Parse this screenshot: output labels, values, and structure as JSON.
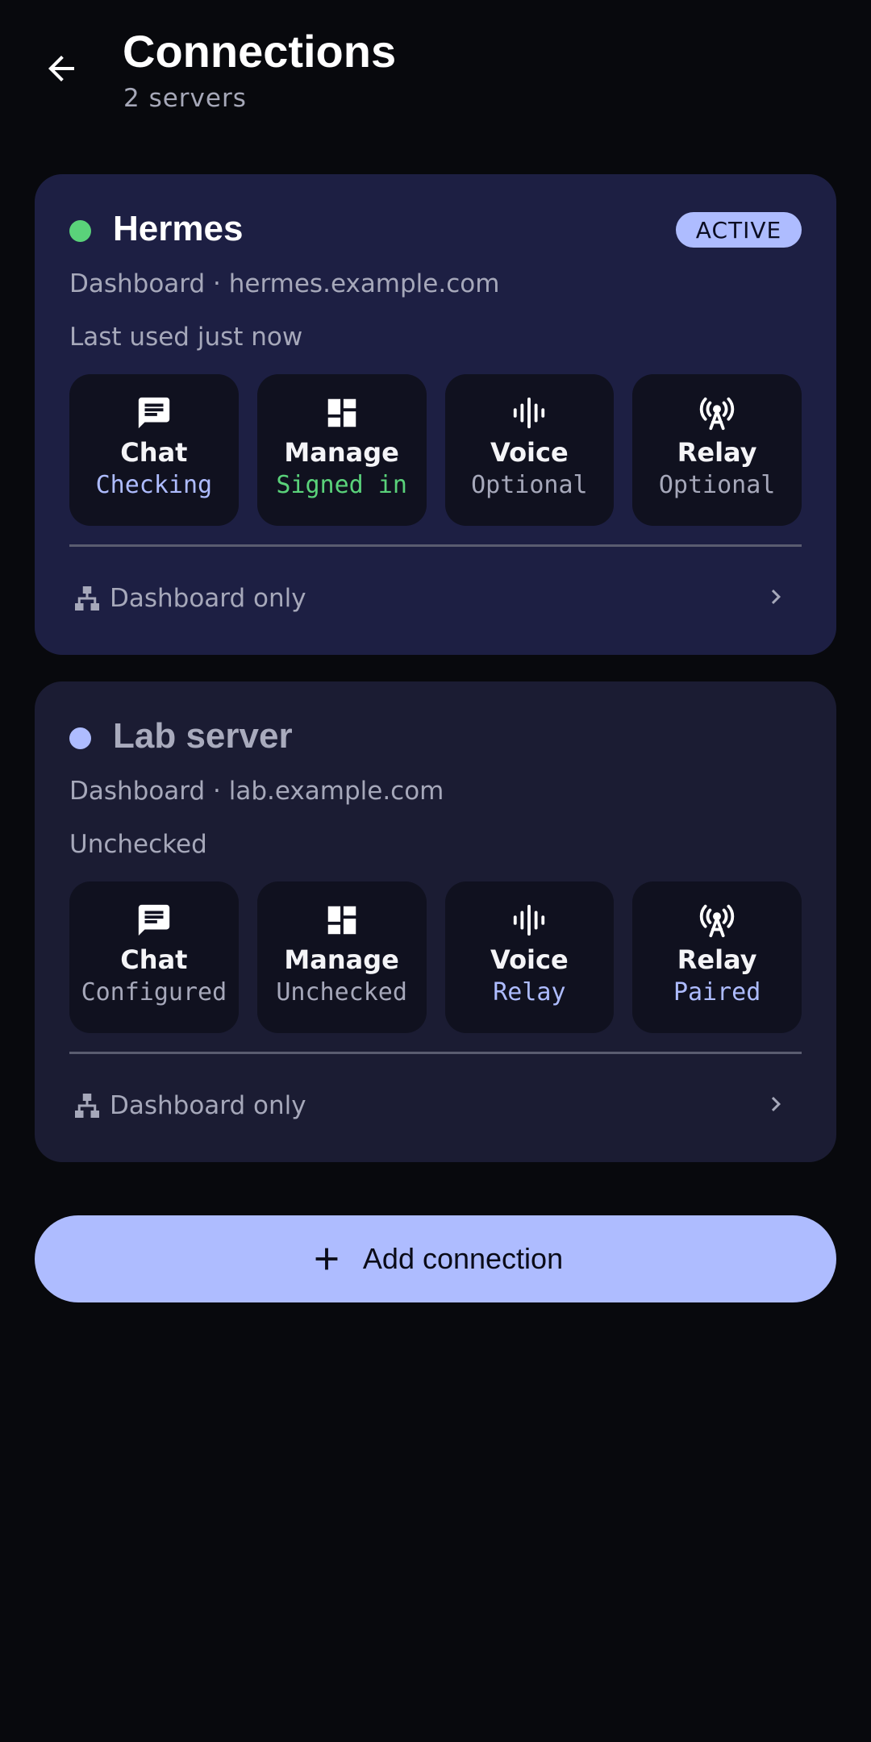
{
  "header": {
    "title": "Connections",
    "subtitle": "2 servers"
  },
  "colors": {
    "background": "#08090d",
    "card_active": "#1d1f43",
    "card_inactive": "#1b1c33",
    "accent": "#aebcff",
    "green": "#5ad27a",
    "muted": "#a6a8ba"
  },
  "connections": [
    {
      "name": "Hermes",
      "status_dot_color": "#5ad27a",
      "badge": "ACTIVE",
      "address": "Dashboard · hermes.example.com",
      "last_used": "Last used just now",
      "tiles": [
        {
          "icon": "chat-icon",
          "label": "Chat",
          "status": "Checking",
          "status_color": "#aebcff"
        },
        {
          "icon": "dashboard-icon",
          "label": "Manage",
          "status": "Signed in",
          "status_color": "#5ad27a"
        },
        {
          "icon": "waveform-icon",
          "label": "Voice",
          "status": "Optional",
          "status_color": "#a6a8ba"
        },
        {
          "icon": "antenna-icon",
          "label": "Relay",
          "status": "Optional",
          "status_color": "#a6a8ba"
        }
      ],
      "footer": "Dashboard only"
    },
    {
      "name": "Lab server",
      "status_dot_color": "#aebcff",
      "address": "Dashboard · lab.example.com",
      "last_used": "Unchecked",
      "tiles": [
        {
          "icon": "chat-icon",
          "label": "Chat",
          "status": "Configured",
          "status_color": "#a6a8ba"
        },
        {
          "icon": "dashboard-icon",
          "label": "Manage",
          "status": "Unchecked",
          "status_color": "#a6a8ba"
        },
        {
          "icon": "waveform-icon",
          "label": "Voice",
          "status": "Relay",
          "status_color": "#aebcff"
        },
        {
          "icon": "antenna-icon",
          "label": "Relay",
          "status": "Paired",
          "status_color": "#aebcff"
        }
      ],
      "footer": "Dashboard only"
    }
  ],
  "add_button": {
    "label": "Add connection",
    "icon": "plus-icon"
  }
}
